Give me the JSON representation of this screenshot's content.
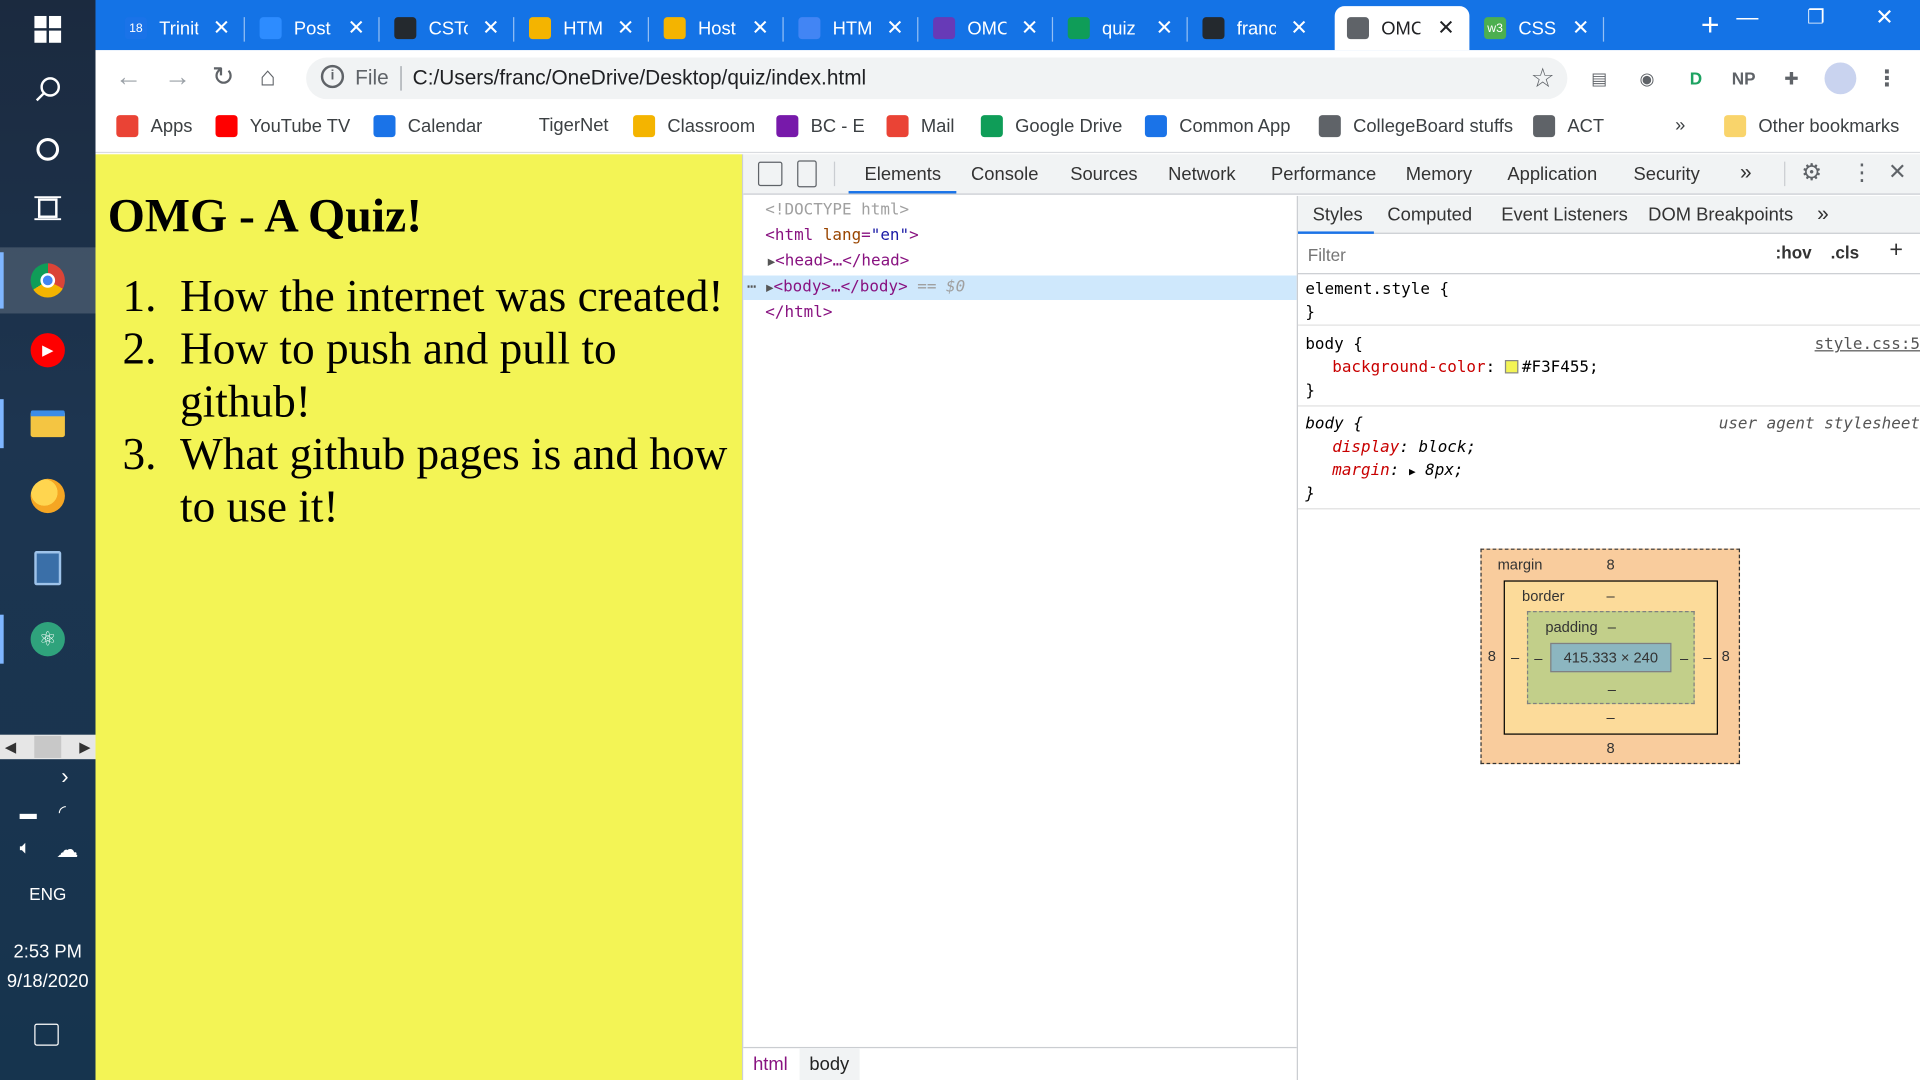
{
  "taskbar": {
    "items": [
      {
        "name": "windows-start",
        "icon": "windows-logo-icon"
      },
      {
        "name": "search",
        "icon": "search-icon"
      },
      {
        "name": "cortana",
        "icon": "cortana-circle-icon"
      },
      {
        "name": "task-view",
        "icon": "task-view-icon"
      },
      {
        "name": "chrome",
        "icon": "chrome-icon"
      },
      {
        "name": "youtube-music",
        "icon": "youtube-music-icon"
      },
      {
        "name": "file-explorer",
        "icon": "folder-icon"
      },
      {
        "name": "weather",
        "icon": "weather-icon"
      },
      {
        "name": "calculator",
        "icon": "calculator-icon"
      },
      {
        "name": "atom",
        "icon": "atom-icon"
      }
    ],
    "language": "ENG",
    "time": "2:53 PM",
    "date": "9/18/2020"
  },
  "tabs": [
    {
      "title": "Trinit",
      "favicon_color": "#1a73e8",
      "favicon_text": "18"
    },
    {
      "title": "Post",
      "favicon_color": "#2d8cff",
      "favicon_text": ""
    },
    {
      "title": "CSTo",
      "favicon_color": "#24292e",
      "favicon_text": ""
    },
    {
      "title": "HTM",
      "favicon_color": "#f4b400",
      "favicon_text": ""
    },
    {
      "title": "Host",
      "favicon_color": "#f4b400",
      "favicon_text": ""
    },
    {
      "title": "HTM",
      "favicon_color": "#4285f4",
      "favicon_text": ""
    },
    {
      "title": "OMC",
      "favicon_color": "#673ab7",
      "favicon_text": ""
    },
    {
      "title": "quiz",
      "favicon_color": "#0f9d58",
      "favicon_text": ""
    },
    {
      "title": "franc",
      "favicon_color": "#24292e",
      "favicon_text": ""
    },
    {
      "title": "OMC",
      "favicon_color": "#5f6368",
      "favicon_text": ""
    },
    {
      "title": "CSS",
      "favicon_color": "#4caf50",
      "favicon_text": "w3"
    }
  ],
  "active_tab_index": 9,
  "omnibox": {
    "scheme_label": "File",
    "url": "C:/Users/franc/OneDrive/Desktop/quiz/index.html"
  },
  "extensions": [
    {
      "name": "reader",
      "text": "▤",
      "color": "#5f6368"
    },
    {
      "name": "keep",
      "text": "◉",
      "color": "#5f6368"
    },
    {
      "name": "idrive",
      "text": "D",
      "color": "#1ea362"
    },
    {
      "name": "np",
      "text": "NP",
      "color": "#5f6368"
    },
    {
      "name": "puzzle",
      "text": "✚",
      "color": "#5f6368"
    }
  ],
  "bookmarks": [
    {
      "label": "Apps",
      "color": "#ea4335",
      "icon": "apps-grid-icon"
    },
    {
      "label": "YouTube TV",
      "color": "#ff0000",
      "icon": "youtube-icon"
    },
    {
      "label": "Calendar",
      "color": "#1a73e8",
      "icon": "calendar-icon"
    },
    {
      "label": "TigerNet",
      "color": "",
      "icon": ""
    },
    {
      "label": "Classroom",
      "color": "#f4b400",
      "icon": "classroom-icon"
    },
    {
      "label": "BC - E",
      "color": "#7719aa",
      "icon": "onenote-icon"
    },
    {
      "label": "Mail",
      "color": "#ea4335",
      "icon": "gmail-icon"
    },
    {
      "label": "Google Drive",
      "color": "#0f9d58",
      "icon": "drive-icon"
    },
    {
      "label": "Common App",
      "color": "#1a73e8",
      "icon": "common-app-icon"
    },
    {
      "label": "CollegeBoard stuffs",
      "color": "#5f6368",
      "icon": "globe-icon"
    },
    {
      "label": "ACT",
      "color": "#5f6368",
      "icon": "globe-icon"
    }
  ],
  "bookmarks_overflow": "»",
  "other_bookmarks": "Other bookmarks",
  "page": {
    "background_color": "#F3F455",
    "heading": "OMG - A Quiz!",
    "items": [
      "How the internet was created!",
      "How to push and pull to github!",
      "What github pages is and how to use it!"
    ]
  },
  "devtools": {
    "tabs": [
      "Elements",
      "Console",
      "Sources",
      "Network",
      "Performance",
      "Memory",
      "Application",
      "Security"
    ],
    "active_tab": "Elements",
    "overflow": "»",
    "dom": {
      "doctype": "<!DOCTYPE html>",
      "html_open": "<html",
      "lang_attr": "lang",
      "lang_value": "\"en\"",
      "head": "<head>…</head>",
      "body": "<body>…</body>",
      "selected_marker": "== $0",
      "html_close": "</html>"
    },
    "breadcrumbs": [
      "html",
      "body"
    ],
    "styles_tabs": [
      "Styles",
      "Computed",
      "Event Listeners",
      "DOM Breakpoints"
    ],
    "styles_overflow": "»",
    "filter_placeholder": "Filter",
    "hov": ":hov",
    "cls": ".cls",
    "plus": "+",
    "rules": {
      "element_style": "element.style {",
      "body_selector": "body",
      "body_source": "style.css:5",
      "bg_prop": "background-color",
      "bg_value": "#F3F455",
      "ua_label": "user agent stylesheet",
      "display_prop": "display",
      "display_value": "block",
      "margin_prop": "margin",
      "margin_value": "8px"
    },
    "box_model": {
      "margin_label": "margin",
      "border_label": "border",
      "padding_label": "padding",
      "margin_top": "8",
      "margin_right": "8",
      "margin_bottom": "8",
      "margin_left": "8",
      "border_value": "–",
      "padding_value": "–",
      "content_size": "415.333 × 240"
    }
  }
}
